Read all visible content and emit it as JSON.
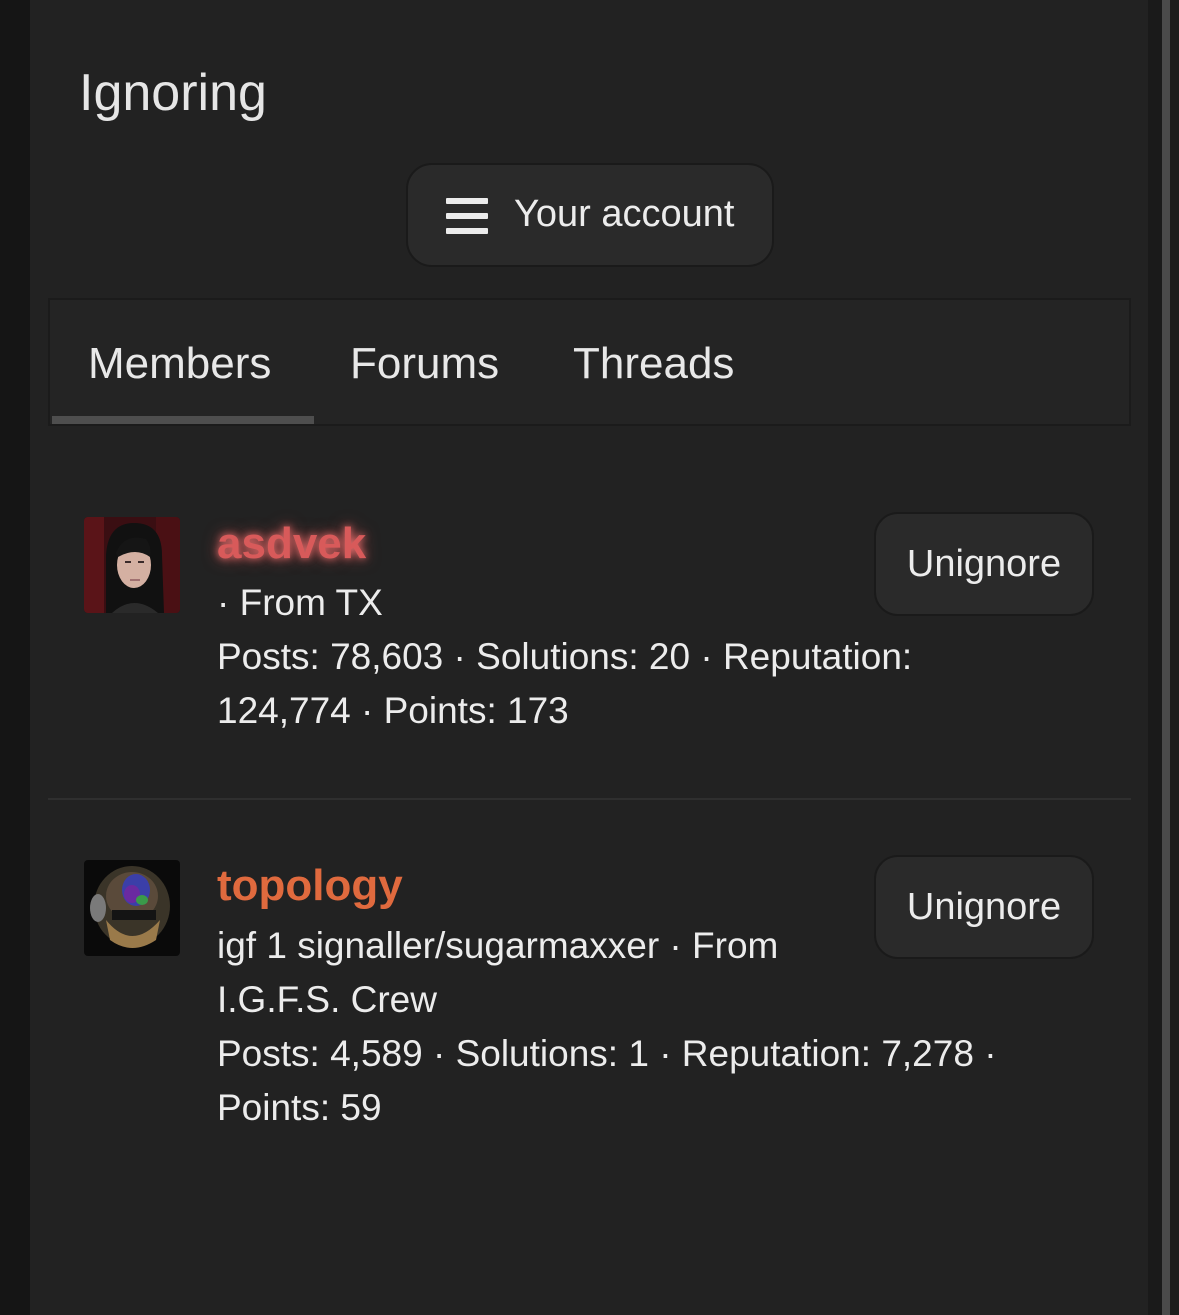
{
  "page": {
    "title": "Ignoring"
  },
  "account_menu": {
    "label": "Your account",
    "icon": "hamburger-icon"
  },
  "tabs": [
    {
      "label": "Members",
      "active": true
    },
    {
      "label": "Forums",
      "active": false
    },
    {
      "label": "Threads",
      "active": false
    }
  ],
  "members": [
    {
      "username": "asdvek",
      "username_color": "#d85a5a",
      "location_line": "· From TX",
      "stats_line_1": "Posts: 78,603 · Solutions: 20 · Reputation:",
      "stats_line_2": "124,774 · Points: 173",
      "action_label": "Unignore"
    },
    {
      "username": "topology",
      "username_color": "#e06a3e",
      "title_line_1": "igf 1 signaller/sugarmaxxer · From",
      "title_line_2": "I.G.F.S. Crew",
      "stats_line_1": "Posts: 4,589 · Solutions: 1 · Reputation: 7,278 ·",
      "stats_line_2": "Points: 59",
      "action_label": "Unignore"
    }
  ],
  "colors": {
    "background": "#151515",
    "panel": "#222222",
    "button": "#2a2a2a",
    "text": "#ececec"
  }
}
